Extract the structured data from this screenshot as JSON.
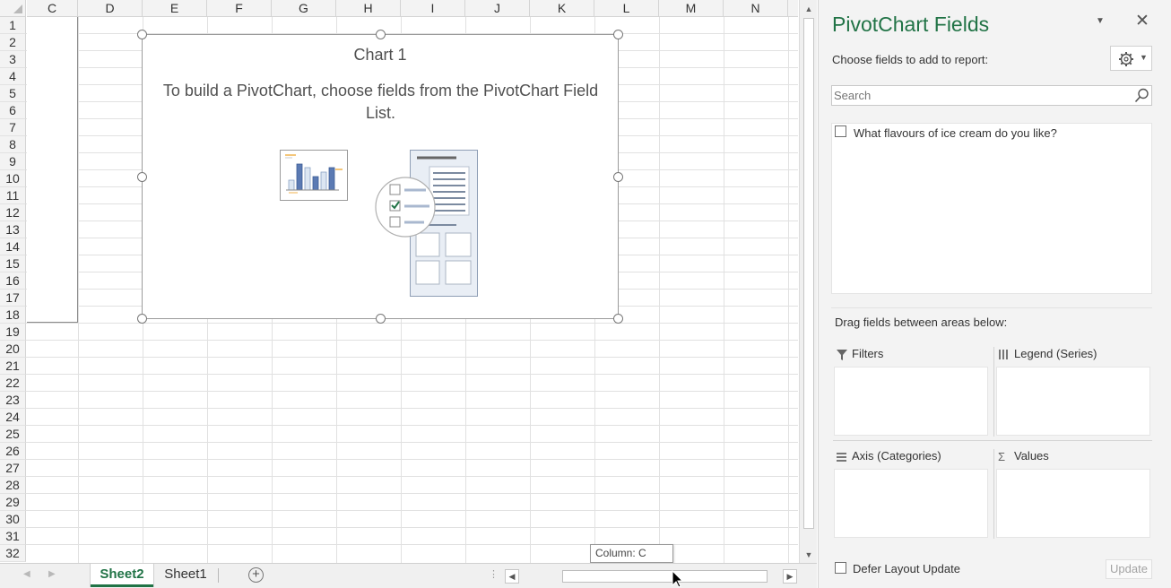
{
  "sheet": {
    "columns": [
      "C",
      "D",
      "E",
      "F",
      "G",
      "H",
      "I",
      "J",
      "K",
      "L",
      "M",
      "N"
    ],
    "rows": [
      "1",
      "2",
      "3",
      "4",
      "5",
      "6",
      "7",
      "8",
      "9",
      "10",
      "11",
      "12",
      "13",
      "14",
      "15",
      "16",
      "17",
      "18",
      "19",
      "20",
      "21",
      "22",
      "23",
      "24",
      "25",
      "26",
      "27",
      "28",
      "29",
      "30",
      "31",
      "32"
    ],
    "chart": {
      "title": "Chart 1",
      "message": "To build a PivotChart, choose fields from the PivotChart Field List."
    },
    "tooltip": "Column: C"
  },
  "tabs": {
    "items": [
      {
        "label": "Sheet2",
        "active": true
      },
      {
        "label": "Sheet1",
        "active": false
      }
    ],
    "add_icon": "plus-circle-icon"
  },
  "pane": {
    "title": "PivotChart Fields",
    "choose_label": "Choose fields to add to report:",
    "search_placeholder": "Search",
    "fields": [
      {
        "label": "What flavours of ice cream do you like?",
        "checked": false
      }
    ],
    "drag_label": "Drag fields between areas below:",
    "areas": {
      "filters": "Filters",
      "legend": "Legend (Series)",
      "axis": "Axis (Categories)",
      "values": "Values"
    },
    "defer_label": "Defer Layout Update",
    "update_label": "Update"
  },
  "colors": {
    "accent": "#217346",
    "grid": "#e1e1e1",
    "header_bg": "#f3f3f3",
    "pane_bg": "#f3f3f3"
  }
}
